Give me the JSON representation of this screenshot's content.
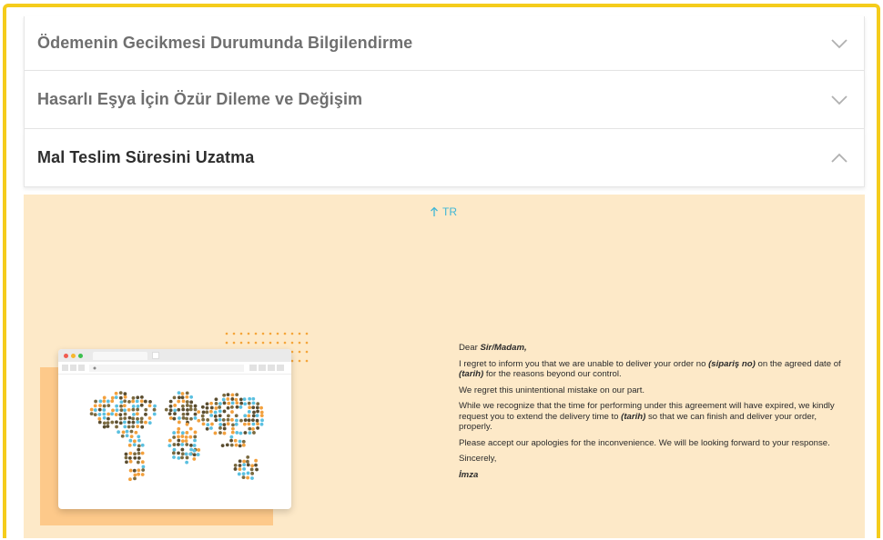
{
  "accordion": {
    "items": [
      {
        "title": "Ödemenin Gecikmesi Durumunda Bilgilendirme",
        "open": false
      },
      {
        "title": "Hasarlı Eşya İçin Özür Dileme ve Değişim",
        "open": false
      },
      {
        "title": "Mal Teslim Süresini Uzatma",
        "open": true
      }
    ]
  },
  "panel": {
    "lang_toggle": "TR",
    "letter": {
      "greeting_prefix": "Dear ",
      "greeting_name": "Sir/Madam,",
      "p1_a": "I regret to inform you that we are unable to deliver your order no ",
      "p1_order": "(sipariş no)",
      "p1_b": " on the agreed date of ",
      "p1_date": "(tarih)",
      "p1_c": " for the reasons beyond our control.",
      "p2": "We regret this unintentional mistake on our part.",
      "p3_a": "While we recognize that the time for performing under this agreement will have expired, we kindly request you to extend the delivery time to ",
      "p3_date": "(tarih)",
      "p3_b": " so that we can finish and deliver your order, properly.",
      "p4": "Please accept our apologies for the inconvenience. We will be looking forward to your response.",
      "closing": "Sincerely,",
      "signature": "İmza"
    }
  },
  "colors": {
    "frame_border": "#f5cc1b",
    "panel_bg": "#fde9c8",
    "lang_toggle": "#3fb6d6",
    "illustration_block": "#fdc98a"
  },
  "icons": {
    "collapsed": "chevron-down-icon",
    "expanded": "chevron-up-icon",
    "lang": "arrow-up-icon"
  }
}
